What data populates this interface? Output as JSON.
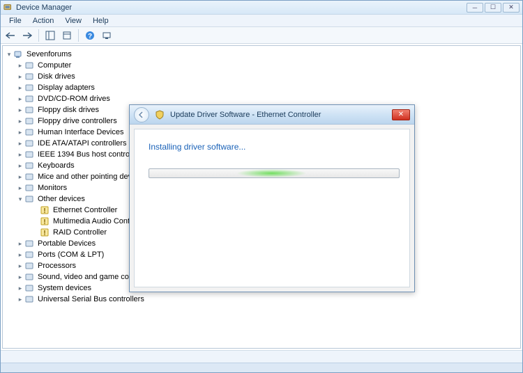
{
  "window": {
    "title": "Device Manager"
  },
  "menu": {
    "file": "File",
    "action": "Action",
    "view": "View",
    "help": "Help"
  },
  "tree": {
    "root": "Sevenforums",
    "items": [
      {
        "label": "Computer",
        "icon": "computer",
        "expanded": false
      },
      {
        "label": "Disk drives",
        "icon": "disk",
        "expanded": false
      },
      {
        "label": "Display adapters",
        "icon": "display",
        "expanded": false
      },
      {
        "label": "DVD/CD-ROM drives",
        "icon": "dvd",
        "expanded": false
      },
      {
        "label": "Floppy disk drives",
        "icon": "floppy",
        "expanded": false
      },
      {
        "label": "Floppy drive controllers",
        "icon": "floppyctl",
        "expanded": false
      },
      {
        "label": "Human Interface Devices",
        "icon": "hid",
        "expanded": false
      },
      {
        "label": "IDE ATA/ATAPI controllers",
        "icon": "ide",
        "expanded": false
      },
      {
        "label": "IEEE 1394 Bus host controllers",
        "icon": "ieee1394",
        "expanded": false
      },
      {
        "label": "Keyboards",
        "icon": "keyboard",
        "expanded": false
      },
      {
        "label": "Mice and other pointing devices",
        "icon": "mouse",
        "expanded": false
      },
      {
        "label": "Monitors",
        "icon": "monitor",
        "expanded": false
      },
      {
        "label": "Other devices",
        "icon": "other",
        "expanded": true,
        "children": [
          {
            "label": "Ethernet Controller",
            "icon": "warn"
          },
          {
            "label": "Multimedia Audio Controller",
            "icon": "warn"
          },
          {
            "label": "RAID Controller",
            "icon": "warn"
          }
        ]
      },
      {
        "label": "Portable Devices",
        "icon": "portable",
        "expanded": false
      },
      {
        "label": "Ports (COM & LPT)",
        "icon": "ports",
        "expanded": false
      },
      {
        "label": "Processors",
        "icon": "cpu",
        "expanded": false
      },
      {
        "label": "Sound, video and game controllers",
        "icon": "sound",
        "expanded": false
      },
      {
        "label": "System devices",
        "icon": "system",
        "expanded": false
      },
      {
        "label": "Universal Serial Bus controllers",
        "icon": "usb",
        "expanded": false
      }
    ]
  },
  "dialog": {
    "title": "Update Driver Software - Ethernet Controller",
    "message": "Installing driver software..."
  }
}
